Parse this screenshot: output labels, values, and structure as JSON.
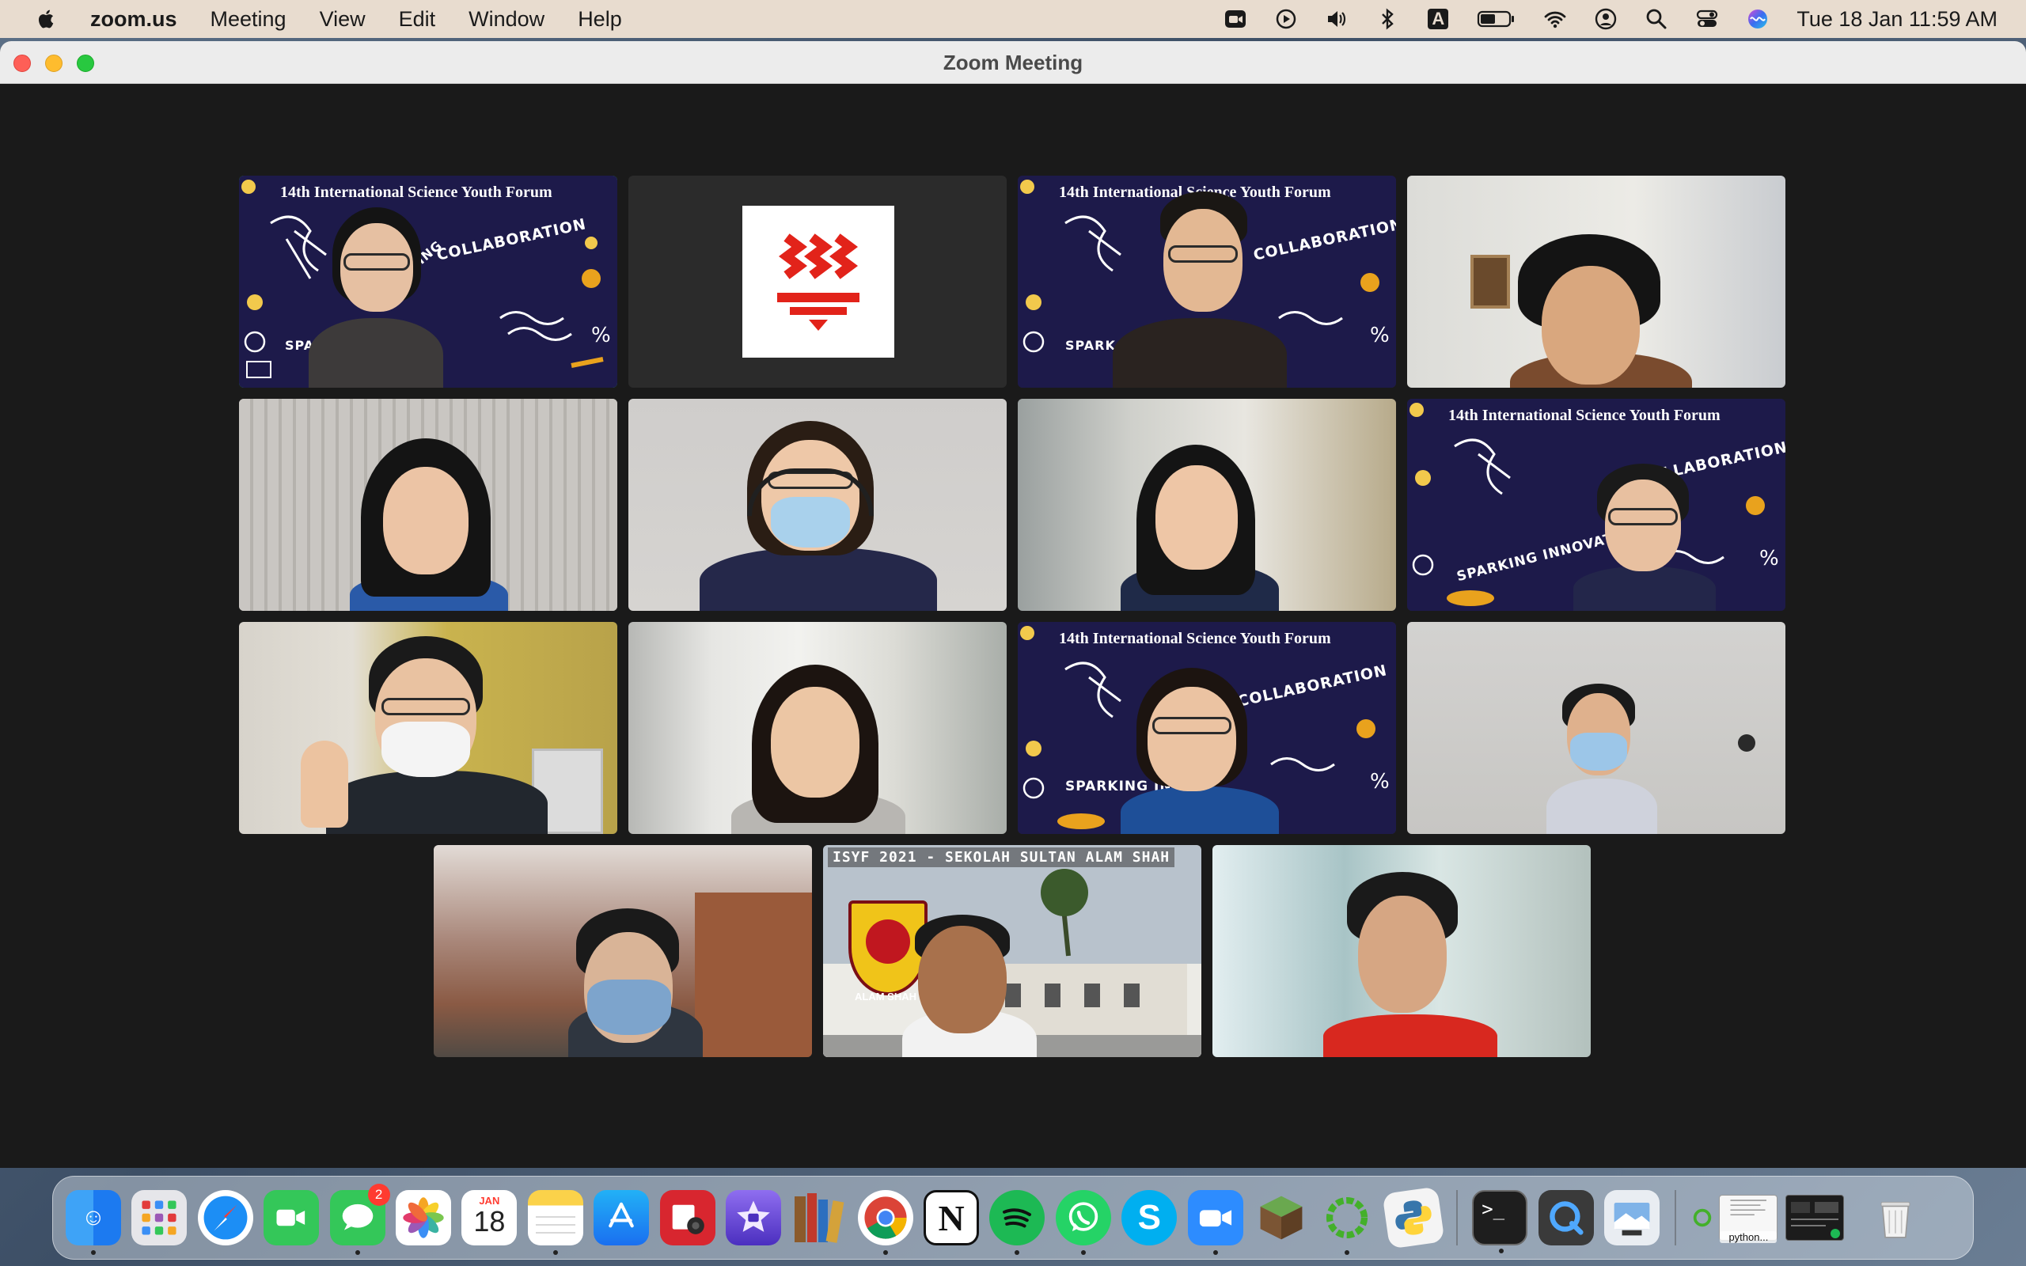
{
  "menubar": {
    "app_name": "zoom.us",
    "menus": [
      "Meeting",
      "View",
      "Edit",
      "Window",
      "Help"
    ],
    "status_icons": [
      "zoom-tray-icon",
      "play-icon",
      "volume-icon",
      "bluetooth-icon",
      "input-source-icon",
      "battery-icon",
      "wifi-icon",
      "user-icon",
      "search-icon",
      "control-center-icon",
      "siri-icon"
    ],
    "input_source_label": "A",
    "clock": "Tue 18 Jan  11:59 AM"
  },
  "window": {
    "title": "Zoom Meeting"
  },
  "banner": {
    "title": "14th International Science Youth Forum",
    "phrase_collaboration": "COLLABORATION",
    "phrase_igniting": "IGNITING",
    "phrase_sparking": "SPARKING",
    "phrase_sparking_innovation": "SPARKING INNOVATI",
    "phrase_sparking_in": "SPARKING IN",
    "phrase_spar": "SPARK"
  },
  "school_banner": {
    "title": "ISYF 2021 - SEKOLAH SULTAN ALAM SHAH",
    "crest_text": "ALAM SHAH"
  },
  "dock": {
    "apps": [
      {
        "name": "Finder",
        "icon": "finder-icon",
        "color": "#3b8ff5",
        "running": true
      },
      {
        "name": "Launchpad",
        "icon": "launchpad-icon",
        "color": "#e8e8e8",
        "running": false
      },
      {
        "name": "Safari",
        "icon": "safari-icon",
        "color": "#1c7cf3",
        "running": false
      },
      {
        "name": "FaceTime",
        "icon": "facetime-icon",
        "color": "#2fbf4a",
        "running": false
      },
      {
        "name": "Messages",
        "icon": "messages-icon",
        "color": "#34c759",
        "running": true,
        "badge": "2"
      },
      {
        "name": "Photos",
        "icon": "photos-icon",
        "color": "#f5f5f5",
        "running": false
      },
      {
        "name": "Calendar",
        "icon": "calendar-icon",
        "color": "#ffffff",
        "running": false,
        "month": "JAN",
        "day": "18"
      },
      {
        "name": "Notes",
        "icon": "notes-icon",
        "color": "#fbe27a",
        "running": true
      },
      {
        "name": "App Store",
        "icon": "app-store-icon",
        "color": "#1a8cf5",
        "running": false
      },
      {
        "name": "Photo Booth",
        "icon": "photo-booth-icon",
        "color": "#d8262f",
        "running": false
      },
      {
        "name": "iMovie",
        "icon": "imovie-icon",
        "color": "#6b4fd8",
        "running": false
      },
      {
        "name": "Calibre",
        "icon": "calibre-icon",
        "color": "#8b5a2b",
        "running": false,
        "label": "CALIBRE"
      },
      {
        "name": "Chrome",
        "icon": "chrome-icon",
        "color": "#ffffff",
        "running": true
      },
      {
        "name": "Notion",
        "icon": "notion-icon",
        "color": "#ffffff",
        "running": false
      },
      {
        "name": "Spotify",
        "icon": "spotify-icon",
        "color": "#1db954",
        "running": true
      },
      {
        "name": "WhatsApp",
        "icon": "whatsapp-icon",
        "color": "#25d366",
        "running": true
      },
      {
        "name": "Skype",
        "icon": "skype-icon",
        "color": "#00aff0",
        "running": false
      },
      {
        "name": "Zoom",
        "icon": "zoom-icon",
        "color": "#2d8cff",
        "running": true
      },
      {
        "name": "Minecraft",
        "icon": "minecraft-icon",
        "color": "#6aa84f",
        "running": false
      },
      {
        "name": "Activity",
        "icon": "ring-icon",
        "color": "#43b02a",
        "running": true
      },
      {
        "name": "Python Launcher",
        "icon": "python-icon",
        "color": "#f2f2f2",
        "running": false
      }
    ],
    "utilities": [
      {
        "name": "Terminal",
        "icon": "terminal-icon",
        "color": "#1e1e1e",
        "running": true
      },
      {
        "name": "QuickTime",
        "icon": "quicktime-icon",
        "color": "#3a3a3a",
        "running": false
      },
      {
        "name": "Preview",
        "icon": "preview-icon",
        "color": "#e9edf2",
        "running": false
      }
    ],
    "minimized_label": "python...",
    "trash_icon": "trash-icon"
  }
}
